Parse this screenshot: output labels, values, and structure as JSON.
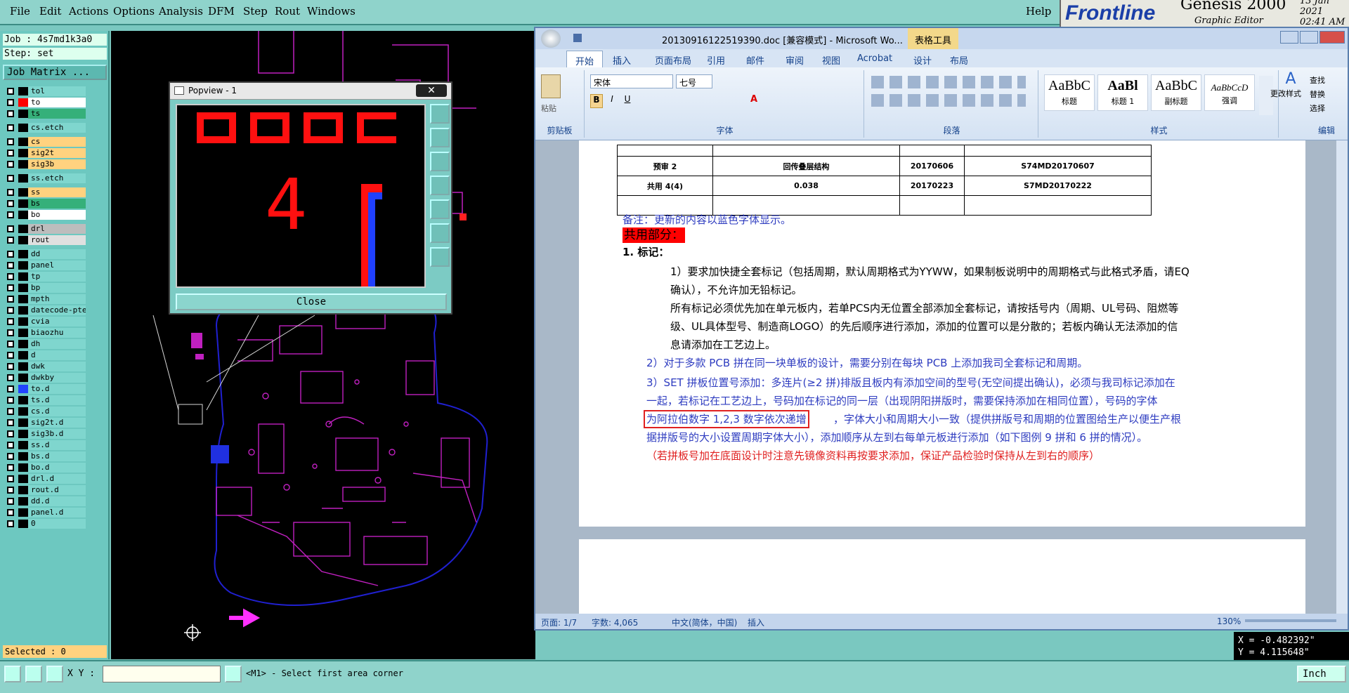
{
  "menubar": {
    "items": [
      "File",
      "Edit",
      "Actions",
      "Options",
      "Analysis",
      "DFM",
      "Step",
      "Rout",
      "Windows"
    ],
    "help": "Help"
  },
  "brand": {
    "logo": "Frontline",
    "app": "Genesis 2000",
    "subtitle": "Graphic Editor",
    "date": "13 Jan 2021",
    "time": "02:41 AM"
  },
  "job": {
    "job_label": "Job : 4s7md1k3a0",
    "step_label": "Step: set",
    "matrix_button": "Job Matrix ..."
  },
  "layers": [
    {
      "name": "tol",
      "swatch": "#000000",
      "bg": "#7fd6ce"
    },
    {
      "name": "to",
      "swatch": "#ff0000",
      "bg": "#ffffff",
      "active": true
    },
    {
      "name": "ts",
      "swatch": "#000000",
      "bg": "#35b07a"
    },
    {
      "name": "cs.etch",
      "swatch": "#000000",
      "bg": "#7fd6ce"
    },
    {
      "name": "cs",
      "swatch": "#000000",
      "bg": "#ffd27f"
    },
    {
      "name": "sig2t",
      "swatch": "#000000",
      "bg": "#ffd27f"
    },
    {
      "name": "sig3b",
      "swatch": "#000000",
      "bg": "#ffd27f"
    },
    {
      "name": "ss.etch",
      "swatch": "#000000",
      "bg": "#7fd6ce"
    },
    {
      "name": "ss",
      "swatch": "#000000",
      "bg": "#ffd27f"
    },
    {
      "name": "bs",
      "swatch": "#000000",
      "bg": "#35b07a"
    },
    {
      "name": "bo",
      "swatch": "#000000",
      "bg": "#ffffff"
    },
    {
      "name": "drl",
      "swatch": "#000000",
      "bg": "#bdbdbd"
    },
    {
      "name": "rout",
      "swatch": "#000000",
      "bg": "#e0e0e0"
    },
    {
      "name": "dd",
      "swatch": "#000000",
      "bg": "#7fd6ce"
    },
    {
      "name": "panel",
      "swatch": "#000000",
      "bg": "#7fd6ce"
    },
    {
      "name": "tp",
      "swatch": "#000000",
      "bg": "#7fd6ce"
    },
    {
      "name": "bp",
      "swatch": "#000000",
      "bg": "#7fd6ce"
    },
    {
      "name": "mpth",
      "swatch": "#000000",
      "bg": "#7fd6ce"
    },
    {
      "name": "datecode-pte",
      "swatch": "#000000",
      "bg": "#7fd6ce"
    },
    {
      "name": "cvia",
      "swatch": "#000000",
      "bg": "#7fd6ce"
    },
    {
      "name": "biaozhu",
      "swatch": "#000000",
      "bg": "#7fd6ce"
    },
    {
      "name": "dh",
      "swatch": "#000000",
      "bg": "#7fd6ce"
    },
    {
      "name": "d",
      "swatch": "#000000",
      "bg": "#7fd6ce"
    },
    {
      "name": "dwk",
      "swatch": "#000000",
      "bg": "#7fd6ce"
    },
    {
      "name": "dwkby",
      "swatch": "#000000",
      "bg": "#7fd6ce"
    },
    {
      "name": "to.d",
      "swatch": "#2244ff",
      "bg": "#7fd6ce"
    },
    {
      "name": "ts.d",
      "swatch": "#000000",
      "bg": "#7fd6ce"
    },
    {
      "name": "cs.d",
      "swatch": "#000000",
      "bg": "#7fd6ce"
    },
    {
      "name": "sig2t.d",
      "swatch": "#000000",
      "bg": "#7fd6ce"
    },
    {
      "name": "sig3b.d",
      "swatch": "#000000",
      "bg": "#7fd6ce"
    },
    {
      "name": "ss.d",
      "swatch": "#000000",
      "bg": "#7fd6ce"
    },
    {
      "name": "bs.d",
      "swatch": "#000000",
      "bg": "#7fd6ce"
    },
    {
      "name": "bo.d",
      "swatch": "#000000",
      "bg": "#7fd6ce"
    },
    {
      "name": "drl.d",
      "swatch": "#000000",
      "bg": "#7fd6ce"
    },
    {
      "name": "rout.d",
      "swatch": "#000000",
      "bg": "#7fd6ce"
    },
    {
      "name": "dd.d",
      "swatch": "#000000",
      "bg": "#7fd6ce"
    },
    {
      "name": "panel.d",
      "swatch": "#000000",
      "bg": "#7fd6ce"
    },
    {
      "name": "0",
      "swatch": "#000000",
      "bg": "#7fd6ce"
    }
  ],
  "selected": "Selected : 0",
  "popview": {
    "title": "Popview - 1",
    "close_x": "✕",
    "close_button": "Close",
    "digit": "4"
  },
  "word": {
    "title": "20130916122519390.doc [兼容模式] - Microsoft Wo...",
    "context_tab": "表格工具",
    "tabs": [
      "开始",
      "插入",
      "页面布局",
      "引用",
      "邮件",
      "审阅",
      "视图",
      "Acrobat",
      "设计",
      "布局"
    ],
    "font_name": "宋体",
    "font_size": "七号",
    "groups": {
      "clipboard": "剪贴板",
      "paste": "粘贴",
      "font": "字体",
      "paragraph": "段落",
      "styles": "样式",
      "edit": "编辑"
    },
    "styles": [
      {
        "sample": "AaBbC",
        "label": "标题"
      },
      {
        "sample": "AaBl",
        "label": "标题 1"
      },
      {
        "sample": "AaBbC",
        "label": "副标题"
      },
      {
        "sample": "AaBbCcD",
        "label": "强调"
      }
    ],
    "change_styles": "更改样式",
    "edit_items": [
      "查找",
      "替换",
      "选择"
    ],
    "table": [
      [
        "预审 2",
        "回传叠层结构",
        "20170606",
        "S74MD20170607"
      ],
      [
        "共用 4(4)",
        "0.038",
        "20170223",
        "S7MD20170222"
      ]
    ],
    "note": "备注：更新的内容以蓝色字体显示。",
    "shared_heading": "共用部分：",
    "mark_heading": "1.   标记：",
    "para1a": "1）要求加快捷全套标记（包括周期，默认周期格式为YYWW，如果制板说明中的周期格式与此格式矛盾，请EQ",
    "para1b": "确认），不允许加无铅标记。",
    "para1c": "所有标记必须优先加在单元板内，若单PCS内无位置全部添加全套标记，请按括号内（周期、UL号码、阻燃等",
    "para1d": "级、UL具体型号、制造商LOGO）的先后顺序进行添加，添加的位置可以是分散的；若板内确认无法添加的信",
    "para1e": "息请添加在工艺边上。",
    "para2": "2）对于多款 PCB 拼在同一块单板的设计，需要分别在每块 PCB 上添加我司全套标记和周期。",
    "para3a": "3）SET 拼板位置号添加：多连片(≥2 拼)排版且板内有添加空间的型号(无空间提出确认)，必须与我司标记添加在",
    "para3b": "一起，若标记在工艺边上，号码加在标记的同一层（出现阴阳拼版时，需要保持添加在相同位置），号码的字体",
    "para3c_box": "为阿拉伯数字  1,2,3  数字依次递增",
    "para3c_rest": "，字体大小和周期大小一致（提供拼版号和周期的位置图给生产以便生产根",
    "para3d": "据拼版号的大小设置周期字体大小），添加顺序从左到右每单元板进行添加（如下图例 9 拼和 6 拼的情况）。",
    "para3e": "（若拼板号加在底面设计时注意先镜像资料再按要求添加，保证产品检验时保持从左到右的顺序）",
    "status": {
      "page": "页面: 1/7",
      "words": "字数: 4,065",
      "lang": "中文(简体，中国)",
      "mode": "插入",
      "zoom": "130%"
    }
  },
  "coords": {
    "x": "X = -0.482392\"",
    "y": "Y =  4.115648\""
  },
  "bottom": {
    "xy_label": "X Y :",
    "xy_value": "",
    "prompt": "<M1> - Select first area corner",
    "units": "Inch"
  },
  "colors": {
    "ui": "#8fd3cb",
    "accent": "#3c8c84",
    "pcb_trace": "#c020c0",
    "pcb_outline": "#2020d0",
    "pcb_red": "#ff0000",
    "doc_blue": "#2e3cc0"
  }
}
